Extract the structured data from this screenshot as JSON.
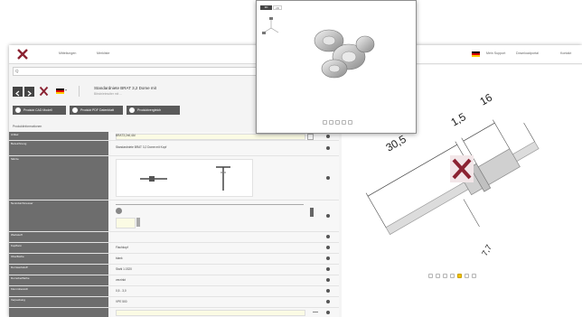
{
  "header": {
    "nav": [
      "Mitteilungen",
      "Merkliste"
    ],
    "user_links": [
      "Mein Support",
      "Downloadportal",
      "Kontakt"
    ],
    "search_placeholder": "Q"
  },
  "product": {
    "title": "Standardniete BRAT 3,2 Dome mit",
    "subtitle": "Blindnietmutter mit ..."
  },
  "toolbar": {
    "buttons": [
      "Produkt CAD Modell",
      "Produkt PDF Datenblatt",
      "Produktvergleich"
    ]
  },
  "left": {
    "section_label": "Produktinformationen",
    "rows": [
      {
        "label": "Artikel",
        "value": "BRAT3,2x6,4Al"
      },
      {
        "label": "Bezeichnung",
        "value": "Standardniete BRAT 3,2 Dome mit Kopf"
      },
      {
        "label": "Skizze",
        "value": ""
      },
      {
        "label": "Nenndurchmesser",
        "value": ""
      },
      {
        "label": "Werkstoff",
        "value": ""
      },
      {
        "label": "Kopfform",
        "value": "Flachkopf"
      },
      {
        "label": "Oberfläche",
        "value": "blank"
      },
      {
        "label": "Dornwerkstoff",
        "value": "Stahl 1.0320"
      },
      {
        "label": "Dornoberfläche",
        "value": "verzinkt"
      },
      {
        "label": "Klemmbereich",
        "value": "0,5 - 3,0"
      },
      {
        "label": "Verpackung",
        "value": "VPE 500"
      }
    ]
  },
  "viewer": {
    "dimensions": {
      "d1": "30,5",
      "d2": "1,5",
      "d3": "16",
      "d4": "7,7"
    }
  },
  "popup": {
    "tabs": [
      "3D",
      "2D"
    ]
  },
  "colors": {
    "accent": "#8b2332",
    "label_bg": "#6d6d6d",
    "toolbar_btn": "#5a5a5a"
  }
}
